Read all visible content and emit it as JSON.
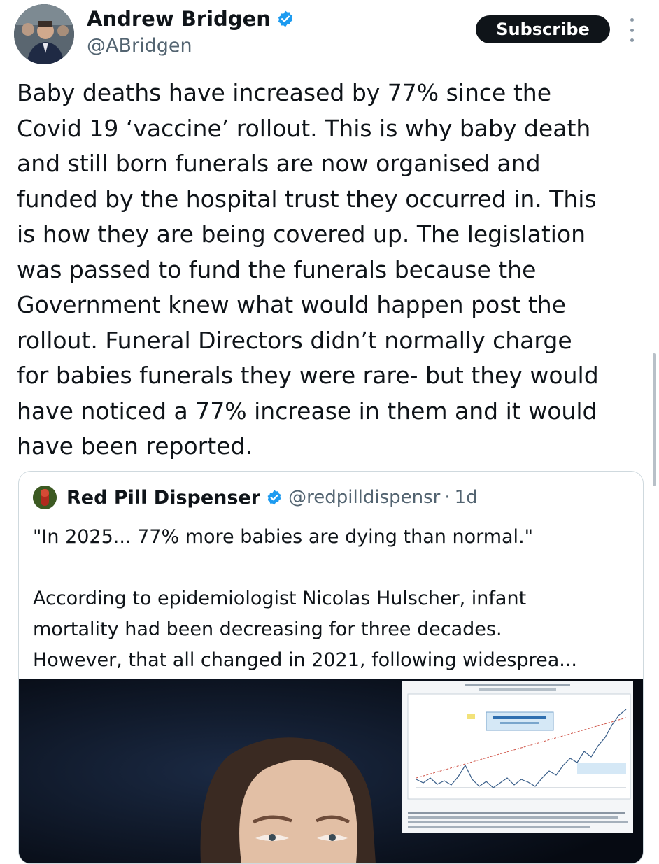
{
  "author": {
    "name": "Andrew Bridgen",
    "handle": "@ABridgen",
    "verified": true,
    "avatar_icon": "profile-photo"
  },
  "actions": {
    "subscribe_label": "Subscribe",
    "more_icon": "vertical-ellipsis-icon"
  },
  "post": {
    "text": "Baby deaths have increased by 77% since the\nCovid 19 ‘vaccine’ rollout. This is why baby death\nand still born funerals are now organised and\nfunded by the hospital trust they occurred in. This\nis how they are being covered up. The legislation\nwas passed to fund the funerals because the\nGovernment knew what would happen post the\nrollout. Funeral Directors didn’t normally charge\nfor babies funerals they were rare- but they would\nhave noticed a 77% increase in them and it would\nhave been reported."
  },
  "quoted": {
    "name": "Red Pill Dispenser",
    "verified": true,
    "handle": "@redpilldispensr",
    "separator": "·",
    "time": "1d",
    "text": "\"In 2025... 77% more babies are dying than normal.\"\n\nAccording to epidemiologist Nicolas Hulscher, infant\nmortality had been decreasing for three decades.\nHowever, that all changed in 2021, following widesprea...",
    "media_icon": "video-thumbnail"
  },
  "colors": {
    "text": "#0f1419",
    "secondary": "#536471",
    "verified": "#1d9bf0",
    "button": "#0f1419",
    "border": "#cfd9de"
  }
}
